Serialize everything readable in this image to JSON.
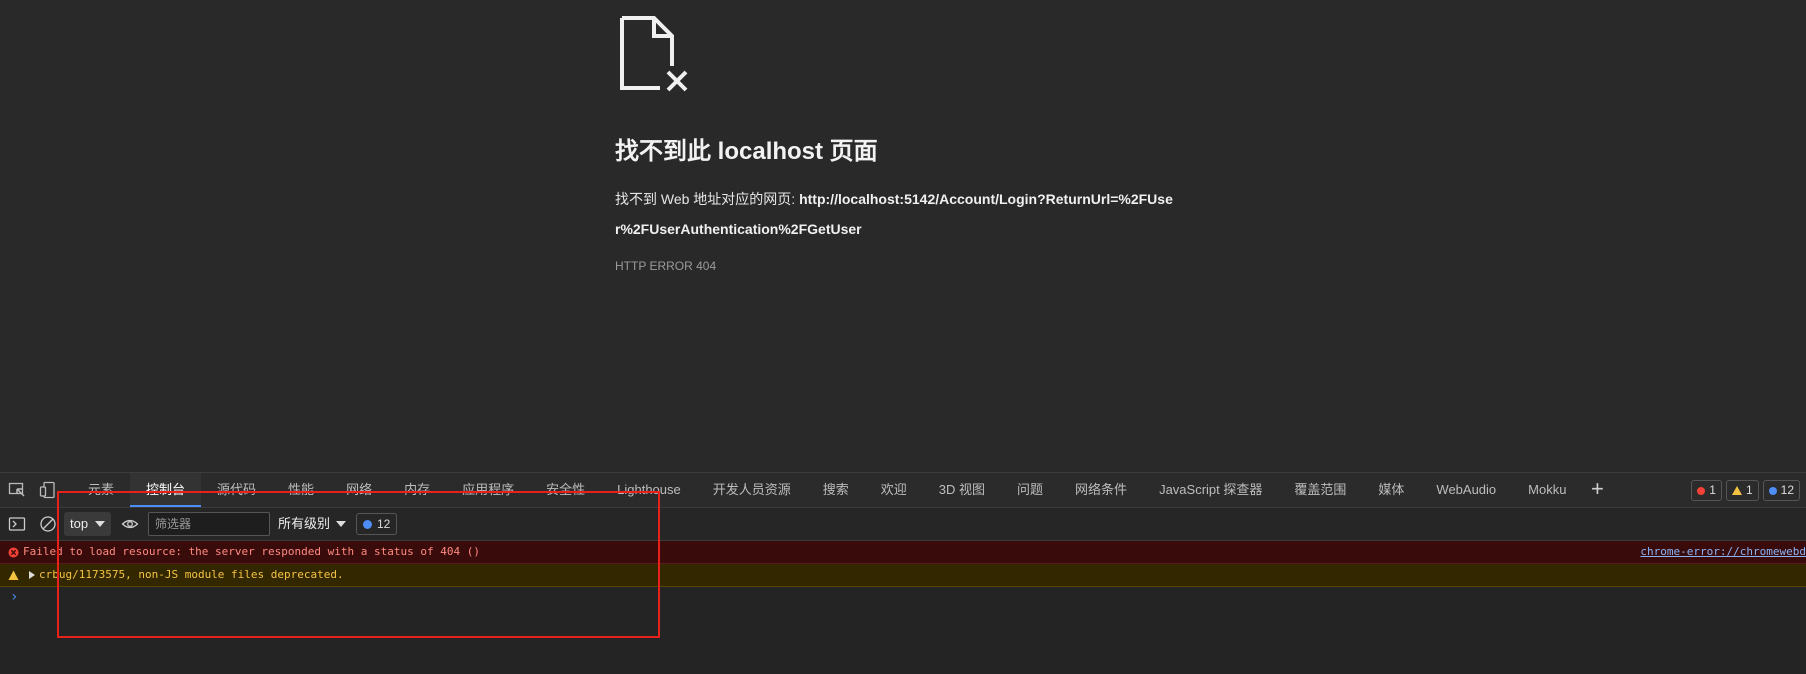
{
  "page": {
    "icon": "missing-file-icon",
    "title": "找不到此 localhost 页面",
    "message_prefix": "找不到 Web 地址对应的网页: ",
    "url": "http://localhost:5142/Account/Login?ReturnUrl=%2FUser%2FUserAuthentication%2FGetUser",
    "error_code": "HTTP ERROR 404"
  },
  "devtools": {
    "tabs": [
      "元素",
      "控制台",
      "源代码",
      "性能",
      "网络",
      "内存",
      "应用程序",
      "安全性",
      "Lighthouse",
      "开发人员资源",
      "搜索",
      "欢迎",
      "3D 视图",
      "问题",
      "网络条件",
      "JavaScript 探查器",
      "覆盖范围",
      "媒体",
      "WebAudio",
      "Mokku"
    ],
    "active_tab": "控制台",
    "counters": {
      "errors": "1",
      "warnings": "1",
      "messages": "12"
    },
    "toolbar": {
      "context": "top",
      "filter_placeholder": "筛选器",
      "level": "所有级别",
      "message_count": "12"
    },
    "log": [
      {
        "level": "error",
        "text": "Failed to load resource: the server responded with a status of 404 ()",
        "source": "chrome-error://chromewebd"
      },
      {
        "level": "warning",
        "text": "crbug/1173575, non-JS module files deprecated."
      }
    ],
    "prompt": "›"
  },
  "colors": {
    "error": "#ff8a80",
    "warning": "#f5c342",
    "accent": "#4c8df6",
    "highlight": "#e8221b"
  }
}
